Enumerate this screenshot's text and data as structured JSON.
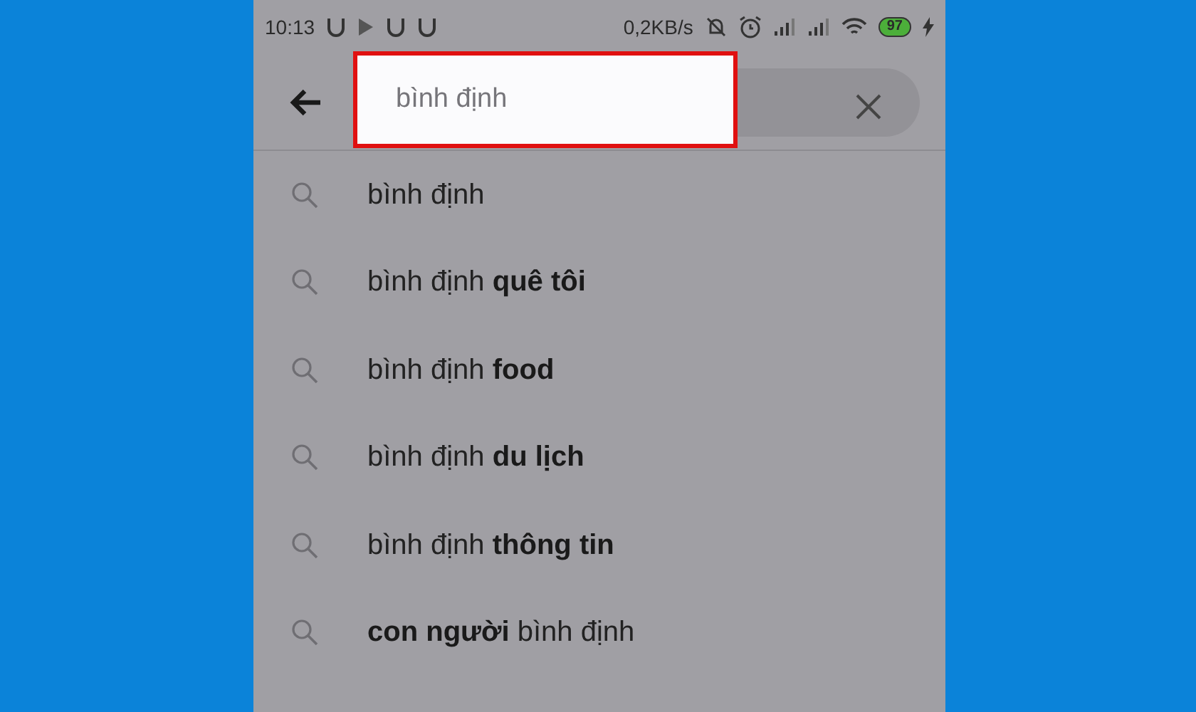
{
  "status_bar": {
    "time": "10:13",
    "speed": "0,2KB/s",
    "battery": "97"
  },
  "search": {
    "value": "bình định",
    "highlighted": true
  },
  "suggestions": [
    {
      "text": "bình định"
    },
    {
      "text": "bình định **quê tôi**"
    },
    {
      "text": "bình định **food**"
    },
    {
      "text": "bình định **du lịch**"
    },
    {
      "text": "bình định **thông tin**"
    },
    {
      "text": "**con người** bình định"
    }
  ]
}
